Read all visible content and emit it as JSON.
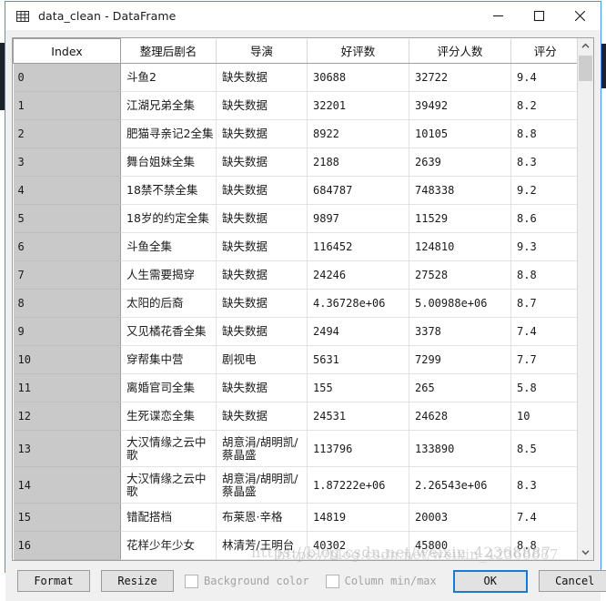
{
  "window": {
    "title": "data_clean - DataFrame",
    "icon": "table-grid-icon",
    "controls": {
      "minimize": "—",
      "maximize": "□",
      "close": "✕"
    },
    "accent_color": "#3d99e8"
  },
  "table": {
    "columns": [
      "Index",
      "整理后剧名",
      "导演",
      "好评数",
      "评分人数",
      "评分"
    ],
    "rows": [
      {
        "index": "0",
        "name": "斗鱼2",
        "director": "缺失数据",
        "good": "30688",
        "count": "32722",
        "score": "9.4"
      },
      {
        "index": "1",
        "name": "江湖兄弟全集",
        "director": "缺失数据",
        "good": "32201",
        "count": "39492",
        "score": "8.2"
      },
      {
        "index": "2",
        "name": "肥猫寻亲记2全集",
        "director": "缺失数据",
        "good": "8922",
        "count": "10105",
        "score": "8.8"
      },
      {
        "index": "3",
        "name": "舞台姐妹全集",
        "director": "缺失数据",
        "good": "2188",
        "count": "2639",
        "score": "8.3"
      },
      {
        "index": "4",
        "name": "18禁不禁全集",
        "director": "缺失数据",
        "good": "684787",
        "count": "748338",
        "score": "9.2"
      },
      {
        "index": "5",
        "name": "18岁的约定全集",
        "director": "缺失数据",
        "good": "9897",
        "count": "11529",
        "score": "8.6"
      },
      {
        "index": "6",
        "name": "斗鱼全集",
        "director": "缺失数据",
        "good": "116452",
        "count": "124810",
        "score": "9.3"
      },
      {
        "index": "7",
        "name": "人生需要揭穿",
        "director": "缺失数据",
        "good": "24246",
        "count": "27528",
        "score": "8.8"
      },
      {
        "index": "8",
        "name": "太阳的后裔",
        "director": "缺失数据",
        "good": "4.36728e+06",
        "count": "5.00988e+06",
        "score": "8.7"
      },
      {
        "index": "9",
        "name": "又见橘花香全集",
        "director": "缺失数据",
        "good": "2494",
        "count": "3378",
        "score": "7.4"
      },
      {
        "index": "10",
        "name": "穿帮集中营",
        "director": "剧视电",
        "good": "5631",
        "count": "7299",
        "score": "7.7"
      },
      {
        "index": "11",
        "name": "离婚官司全集",
        "director": "缺失数据",
        "good": "155",
        "count": "265",
        "score": "5.8"
      },
      {
        "index": "12",
        "name": "生死谍恋全集",
        "director": "缺失数据",
        "good": "24531",
        "count": "24628",
        "score": "10"
      },
      {
        "index": "13",
        "name": "大汉情缘之云中歌",
        "director": "胡意涓/胡明凯/蔡晶盛",
        "good": "113796",
        "count": "133890",
        "score": "8.5",
        "tall": true
      },
      {
        "index": "14",
        "name": "大汉情缘之云中歌",
        "director": "胡意涓/胡明凯/蔡晶盛",
        "good": "1.87222e+06",
        "count": "2.26543e+06",
        "score": "8.3",
        "tall": true
      },
      {
        "index": "15",
        "name": "错配搭档",
        "director": "布莱恩·辛格",
        "good": "14819",
        "count": "20003",
        "score": "7.4"
      },
      {
        "index": "16",
        "name": "花样少年少女",
        "director": "林清芳/王明台",
        "good": "40302",
        "count": "45800",
        "score": "8.8"
      }
    ]
  },
  "scrollbar": {
    "up_arrow_icon": "chevron-up-icon",
    "down_arrow_icon": "chevron-down-icon"
  },
  "footer": {
    "format_label": "Format",
    "resize_label": "Resize",
    "background_color_label": "Background color",
    "column_minmax_label": "Column min/max",
    "ok_label": "OK",
    "cancel_label": "Cancel"
  },
  "watermark": {
    "line1": "https://blog.csdn.net/weixin_42368887",
    "line2": "https://blog.csdn.net/weixin_42368887"
  }
}
